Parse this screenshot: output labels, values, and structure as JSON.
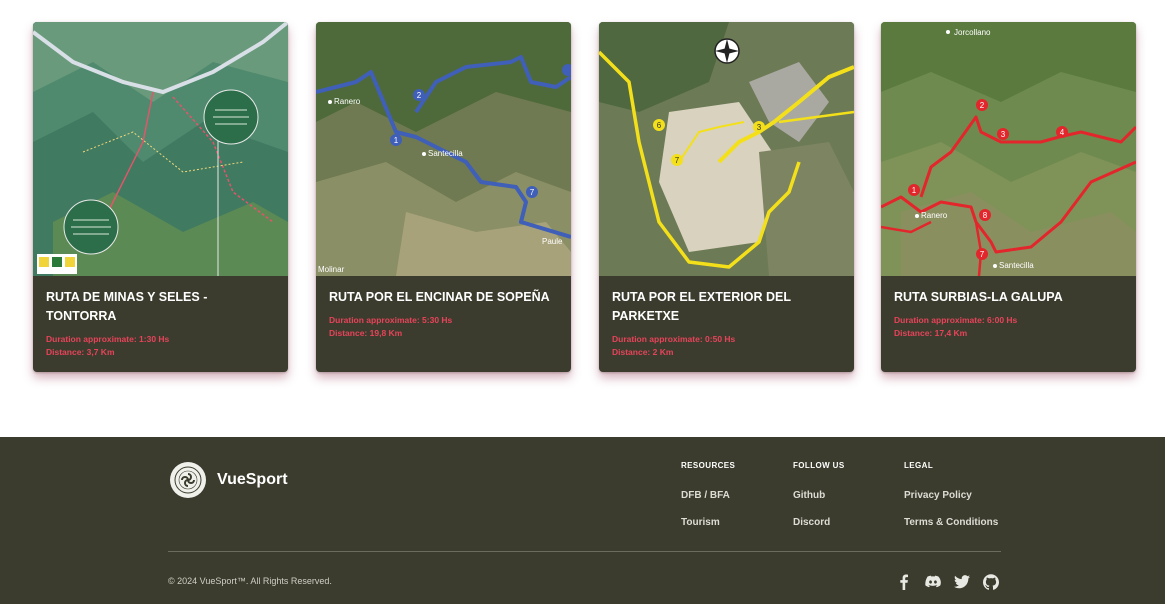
{
  "routes": [
    {
      "title": "RUTA DE MINAS Y SELES - TONTORRA",
      "duration": "Duration approximate: 1:30 Hs",
      "distance": "Distance: 3,7 Km"
    },
    {
      "title": "RUTA POR EL ENCINAR DE SOPEÑA",
      "duration": "Duration approximate: 5:30 Hs",
      "distance": "Distance: 19,8 Km",
      "map_labels": {
        "town": "Santecilla",
        "west": "Ranero",
        "south": "Molinar",
        "east": "Paule"
      }
    },
    {
      "title": "RUTA POR EL EXTERIOR DEL PARKETXE",
      "duration": "Duration approximate: 0:50 Hs",
      "distance": "Distance: 2 Km"
    },
    {
      "title": "RUTA SURBIAS-LA GALUPA",
      "duration": "Duration approximate: 6:00 Hs",
      "distance": "Distance: 17,4 Km",
      "map_labels": {
        "north": "Jorcollano",
        "west": "Ranero",
        "town": "Santecilla"
      }
    }
  ],
  "footer": {
    "brand": "VueSport",
    "resources": {
      "heading": "RESOURCES",
      "links": [
        "DFB / BFA",
        "Tourism"
      ]
    },
    "follow": {
      "heading": "FOLLOW US",
      "links": [
        "Github",
        "Discord"
      ]
    },
    "legal": {
      "heading": "LEGAL",
      "links": [
        "Privacy Policy",
        "Terms & Conditions"
      ]
    },
    "copyright": "© 2024 VueSport™. All Rights Reserved.",
    "social_icons": [
      "facebook-icon",
      "discord-icon",
      "twitter-icon",
      "github-icon"
    ]
  },
  "colors": {
    "card_bg": "#3b3c2d",
    "footer_bg": "#3b3c2d",
    "meta_text": "#e8435a",
    "route_blue": "#3f5fb8",
    "route_yellow": "#f3e01a",
    "route_red": "#e3262b"
  }
}
